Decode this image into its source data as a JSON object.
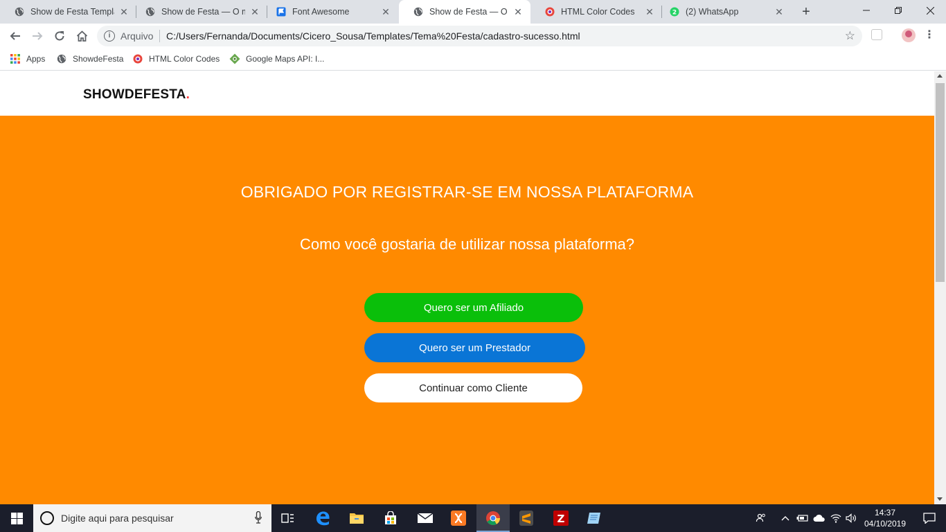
{
  "browser": {
    "tabs": [
      {
        "title": "Show de Festa Templat",
        "favicon": "globe-icon",
        "active": false
      },
      {
        "title": "Show de Festa — O ma",
        "favicon": "globe-icon",
        "active": false
      },
      {
        "title": "Font Awesome",
        "favicon": "flag-icon",
        "active": false
      },
      {
        "title": "Show de Festa — O ma",
        "favicon": "globe-icon",
        "active": true
      },
      {
        "title": "HTML Color Codes",
        "favicon": "color-codes-icon",
        "active": false
      },
      {
        "title": "(2) WhatsApp",
        "favicon": "whatsapp-icon",
        "badge": "2",
        "active": false
      }
    ],
    "new_tab_symbol": "+",
    "address": {
      "security_label": "Arquivo",
      "url": "C:/Users/Fernanda/Documents/Cicero_Sousa/Templates/Tema%20Festa/cadastro-sucesso.html"
    },
    "bookmarks": [
      {
        "label": "Apps",
        "icon": "apps-grid-icon"
      },
      {
        "label": "ShowdeFesta",
        "icon": "globe-icon"
      },
      {
        "label": "HTML Color Codes",
        "icon": "color-codes-icon"
      },
      {
        "label": "Google Maps API: I...",
        "icon": "maps-icon"
      }
    ]
  },
  "page": {
    "logo": {
      "text": "SHOWDEFESTA",
      "dot": "."
    },
    "headline": "OBRIGADO POR REGISTRAR-SE EM NOSSA PLATAFORMA",
    "question": "Como você gostaria de utilizar nossa plataforma?",
    "buttons": {
      "affiliate": "Quero ser um Afiliado",
      "provider": "Quero ser um Prestador",
      "client": "Continuar como Cliente"
    },
    "colors": {
      "hero_background": "#ff8a00",
      "affiliate_button": "#0abf0a",
      "provider_button": "#0a75d6",
      "client_button": "#ffffff",
      "logo_dot": "#ff3b3b"
    }
  },
  "taskbar": {
    "search_placeholder": "Digite aqui para pesquisar",
    "pinned": [
      "task-view-icon",
      "edge-icon",
      "file-explorer-icon",
      "store-icon",
      "mail-icon",
      "xampp-icon",
      "chrome-icon",
      "sublime-text-icon",
      "filezilla-icon",
      "notepad-icon"
    ],
    "clock": {
      "time": "14:37",
      "date": "04/10/2019"
    }
  }
}
